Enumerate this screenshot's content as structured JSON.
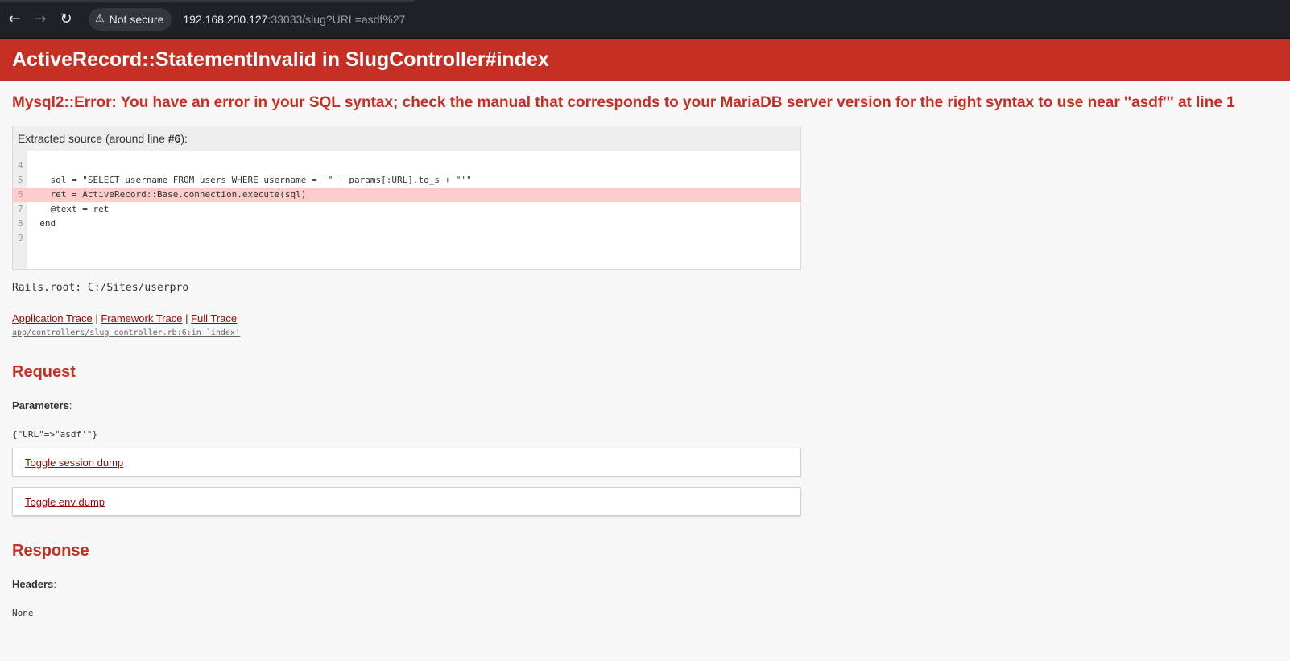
{
  "browser": {
    "security_label": "Not secure",
    "url_host": "192.168.200.127",
    "url_rest": ":33033/slug?URL=asdf%27"
  },
  "page": {
    "title": "ActiveRecord::StatementInvalid in SlugController#index",
    "error_message": "Mysql2::Error: You have an error in your SQL syntax; check the manual that corresponds to your MariaDB server version for the right syntax to use near ''asdf''' at line 1"
  },
  "source": {
    "info_prefix": "Extracted source (around line ",
    "info_line": "#6",
    "info_suffix": "):",
    "lines": [
      {
        "num": "4",
        "code": ""
      },
      {
        "num": "5",
        "code": "    sql = \"SELECT username FROM users WHERE username = '\" + params[:URL].to_s + \"'\""
      },
      {
        "num": "6",
        "code": "    ret = ActiveRecord::Base.connection.execute(sql)"
      },
      {
        "num": "7",
        "code": "    @text = ret"
      },
      {
        "num": "8",
        "code": "  end"
      },
      {
        "num": "9",
        "code": ""
      }
    ],
    "highlight_line": "6"
  },
  "rails_root": "Rails.root: C:/Sites/userpro",
  "trace": {
    "application": "Application Trace",
    "framework": "Framework Trace",
    "full": "Full Trace",
    "separator": " | ",
    "line": "app/controllers/slug_controller.rb:6:in `index'"
  },
  "request": {
    "heading": "Request",
    "parameters_label": "Parameters",
    "parameters_value": "{\"URL\"=>\"asdf'\"}",
    "toggle_session": "Toggle session dump",
    "toggle_env": "Toggle env dump"
  },
  "response": {
    "heading": "Response",
    "headers_label": "Headers",
    "headers_value": "None"
  },
  "colors": {
    "header_red": "#c52f24",
    "link_red": "#980905",
    "highlight": "#ffcccc"
  }
}
